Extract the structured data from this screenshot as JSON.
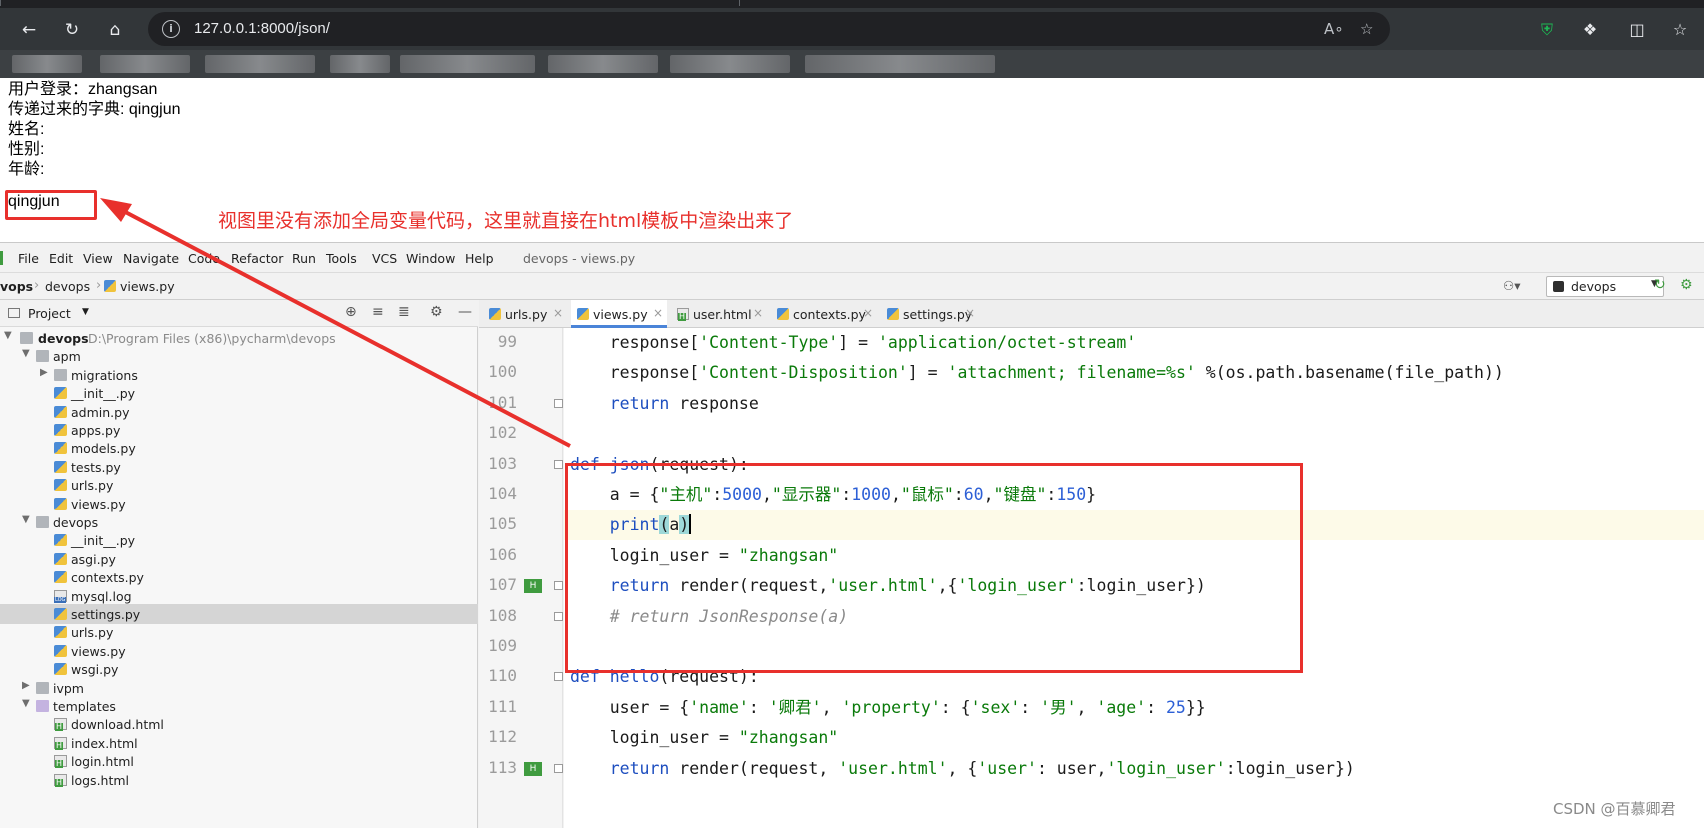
{
  "browser": {
    "url": "127.0.0.1:8000/json/"
  },
  "page": {
    "lines": [
      "用户登录：zhangsan",
      "传递过来的字典: qingjun",
      "姓名:",
      "性别:",
      "年龄:",
      "qingjun"
    ],
    "annotation": "视图里没有添加全局变量代码，这里就直接在html模板中渲染出来了"
  },
  "ide": {
    "menu": [
      "File",
      "Edit",
      "View",
      "Navigate",
      "Code",
      "Refactor",
      "Run",
      "Tools",
      "VCS",
      "Window",
      "Help"
    ],
    "title": "devops - views.py",
    "breadcrumbs": [
      "vops",
      "devops",
      "views.py"
    ],
    "run_config": "devops",
    "project_panel_title": "Project",
    "project_root": {
      "name": "devops",
      "path": "D:\\Program Files (x86)\\pycharm\\devops"
    },
    "tree": [
      {
        "label": "apm",
        "type": "folder",
        "depth": 1,
        "expanded": true
      },
      {
        "label": "migrations",
        "type": "folder",
        "depth": 2,
        "expanded": false
      },
      {
        "label": "__init__.py",
        "type": "py",
        "depth": 2
      },
      {
        "label": "admin.py",
        "type": "py",
        "depth": 2
      },
      {
        "label": "apps.py",
        "type": "py",
        "depth": 2
      },
      {
        "label": "models.py",
        "type": "py",
        "depth": 2
      },
      {
        "label": "tests.py",
        "type": "py",
        "depth": 2
      },
      {
        "label": "urls.py",
        "type": "py",
        "depth": 2
      },
      {
        "label": "views.py",
        "type": "py",
        "depth": 2
      },
      {
        "label": "devops",
        "type": "folder",
        "depth": 1,
        "expanded": true
      },
      {
        "label": "__init__.py",
        "type": "py",
        "depth": 2
      },
      {
        "label": "asgi.py",
        "type": "py",
        "depth": 2
      },
      {
        "label": "contexts.py",
        "type": "py",
        "depth": 2
      },
      {
        "label": "mysql.log",
        "type": "log",
        "depth": 2
      },
      {
        "label": "settings.py",
        "type": "py",
        "depth": 2,
        "selected": true
      },
      {
        "label": "urls.py",
        "type": "py",
        "depth": 2
      },
      {
        "label": "views.py",
        "type": "py",
        "depth": 2
      },
      {
        "label": "wsgi.py",
        "type": "py",
        "depth": 2
      },
      {
        "label": "ivpm",
        "type": "folder",
        "depth": 1,
        "expanded": false
      },
      {
        "label": "templates",
        "type": "folder-purple",
        "depth": 1,
        "expanded": true
      },
      {
        "label": "download.html",
        "type": "html",
        "depth": 2
      },
      {
        "label": "index.html",
        "type": "html",
        "depth": 2
      },
      {
        "label": "login.html",
        "type": "html",
        "depth": 2
      },
      {
        "label": "logs.html",
        "type": "html",
        "depth": 2
      }
    ],
    "tabs": [
      {
        "label": "urls.py",
        "type": "py",
        "active": false
      },
      {
        "label": "views.py",
        "type": "py",
        "active": true
      },
      {
        "label": "user.html",
        "type": "html",
        "active": false
      },
      {
        "label": "contexts.py",
        "type": "py",
        "active": false
      },
      {
        "label": "settings.py",
        "type": "py",
        "active": false
      }
    ],
    "code_lines": [
      {
        "n": "99",
        "tokens": [
          [
            "",
            "    response["
          ],
          [
            "str",
            "'Content-Type'"
          ],
          [
            "",
            "] = "
          ],
          [
            "str",
            "'application/octet-stream'"
          ]
        ]
      },
      {
        "n": "100",
        "tokens": [
          [
            "",
            "    response["
          ],
          [
            "str",
            "'Content-Disposition'"
          ],
          [
            "",
            "] = "
          ],
          [
            "str",
            "'attachment; filename=%s'"
          ],
          [
            "",
            " %(os.path.basename(file_path))"
          ]
        ]
      },
      {
        "n": "101",
        "tokens": [
          [
            "kw",
            "    return"
          ],
          [
            "",
            " response"
          ]
        ]
      },
      {
        "n": "102",
        "tokens": []
      },
      {
        "n": "103",
        "tokens": [
          [
            "kw",
            "def "
          ],
          [
            "fn",
            "json"
          ],
          [
            "",
            "(request):"
          ]
        ]
      },
      {
        "n": "104",
        "tokens": [
          [
            "",
            "    a = {"
          ],
          [
            "str",
            "\"主机\""
          ],
          [
            "",
            ":"
          ],
          [
            "num",
            "5000"
          ],
          [
            "",
            ","
          ],
          [
            "str",
            "\"显示器\""
          ],
          [
            "",
            ":"
          ],
          [
            "num",
            "1000"
          ],
          [
            "",
            ","
          ],
          [
            "str",
            "\"鼠标\""
          ],
          [
            "",
            ":"
          ],
          [
            "num",
            "60"
          ],
          [
            "",
            ","
          ],
          [
            "str",
            "\"键盘\""
          ],
          [
            "",
            ":"
          ],
          [
            "num",
            "150"
          ],
          [
            "",
            "}"
          ]
        ]
      },
      {
        "n": "105",
        "current": true,
        "tokens": [
          [
            "kw",
            "    print"
          ],
          [
            "brace",
            "("
          ],
          [
            "",
            "a"
          ],
          [
            "brace",
            ")"
          ],
          [
            "caret",
            ""
          ]
        ]
      },
      {
        "n": "106",
        "tokens": [
          [
            "",
            "    login_user = "
          ],
          [
            "str",
            "\"zhangsan\""
          ]
        ]
      },
      {
        "n": "107",
        "tokens": [
          [
            "kw",
            "    return"
          ],
          [
            "",
            " render(request,"
          ],
          [
            "str",
            "'user.html'"
          ],
          [
            "",
            ",{"
          ],
          [
            "str",
            "'login_user'"
          ],
          [
            "",
            ":login_user})"
          ]
        ]
      },
      {
        "n": "108",
        "tokens": [
          [
            "cmt",
            "    # return JsonResponse(a)"
          ]
        ]
      },
      {
        "n": "109",
        "tokens": []
      },
      {
        "n": "110",
        "tokens": [
          [
            "kw",
            "def "
          ],
          [
            "fn",
            "hello"
          ],
          [
            "",
            "(request):"
          ]
        ]
      },
      {
        "n": "111",
        "tokens": [
          [
            "",
            "    user = {"
          ],
          [
            "str",
            "'name'"
          ],
          [
            "",
            ": "
          ],
          [
            "str",
            "'卿君'"
          ],
          [
            "",
            ", "
          ],
          [
            "str",
            "'property'"
          ],
          [
            "",
            ": {"
          ],
          [
            "str",
            "'sex'"
          ],
          [
            "",
            ": "
          ],
          [
            "str",
            "'男'"
          ],
          [
            "",
            ", "
          ],
          [
            "str",
            "'age'"
          ],
          [
            "",
            ": "
          ],
          [
            "num",
            "25"
          ],
          [
            "",
            "}}"
          ]
        ]
      },
      {
        "n": "112",
        "tokens": [
          [
            "",
            "    login_user = "
          ],
          [
            "str",
            "\"zhangsan\""
          ]
        ]
      },
      {
        "n": "113",
        "tokens": [
          [
            "kw",
            "    return"
          ],
          [
            "",
            " render(request, "
          ],
          [
            "str",
            "'user.html'"
          ],
          [
            "",
            ", {"
          ],
          [
            "str",
            "'user'"
          ],
          [
            "",
            ": user,"
          ],
          [
            "str",
            "'login_user'"
          ],
          [
            "",
            ":login_user})"
          ]
        ]
      }
    ]
  },
  "watermark": "CSDN @百慕卿君",
  "colors": {
    "annotation": "#e8302c",
    "keyword": "#1d4ebf",
    "string": "#0a7a0a",
    "number": "#2c5fd6"
  }
}
